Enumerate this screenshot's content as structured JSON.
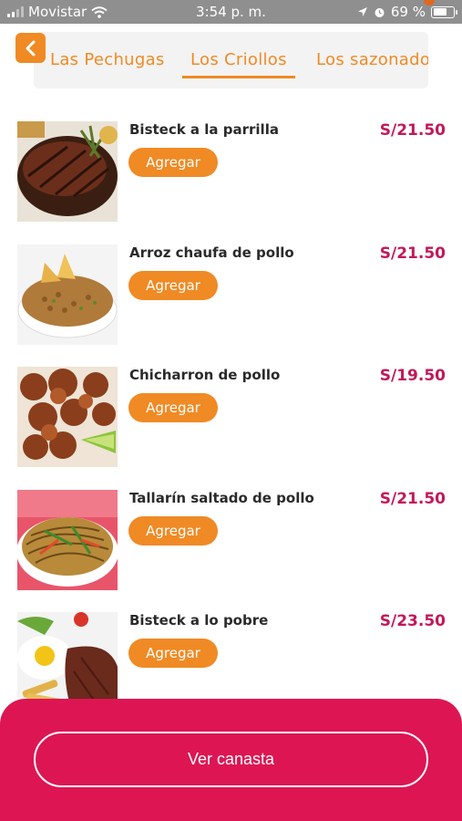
{
  "status_bar": {
    "carrier": "Movistar",
    "time": "3:54 p. m.",
    "battery": "69 %",
    "battery_level": 0.69
  },
  "nav": {
    "back_icon": "chevron-left-icon",
    "tabs": [
      {
        "label": "Las Pechugas",
        "active": false
      },
      {
        "label": "Los Criollos",
        "active": true
      },
      {
        "label": "Los sazonado",
        "active": false
      }
    ]
  },
  "products": [
    {
      "name": "Bisteck a la parrilla",
      "price": "S/21.50",
      "button": "Agregar",
      "image": "grilled-steak-image"
    },
    {
      "name": "Arroz chaufa de pollo",
      "price": "S/21.50",
      "button": "Agregar",
      "image": "fried-rice-image"
    },
    {
      "name": "Chicharron de pollo",
      "price": "S/19.50",
      "button": "Agregar",
      "image": "fried-chicken-image"
    },
    {
      "name": "Tallarín saltado de pollo",
      "price": "S/21.50",
      "button": "Agregar",
      "image": "stir-fried-noodles-image"
    },
    {
      "name": "Bisteck a lo pobre",
      "price": "S/23.50",
      "button": "Agregar",
      "image": "steak-egg-plate-image"
    }
  ],
  "basket": {
    "label": "Ver canasta"
  },
  "colors": {
    "accent": "#f08a24",
    "brand": "#dd1653",
    "price": "#c2185b"
  }
}
